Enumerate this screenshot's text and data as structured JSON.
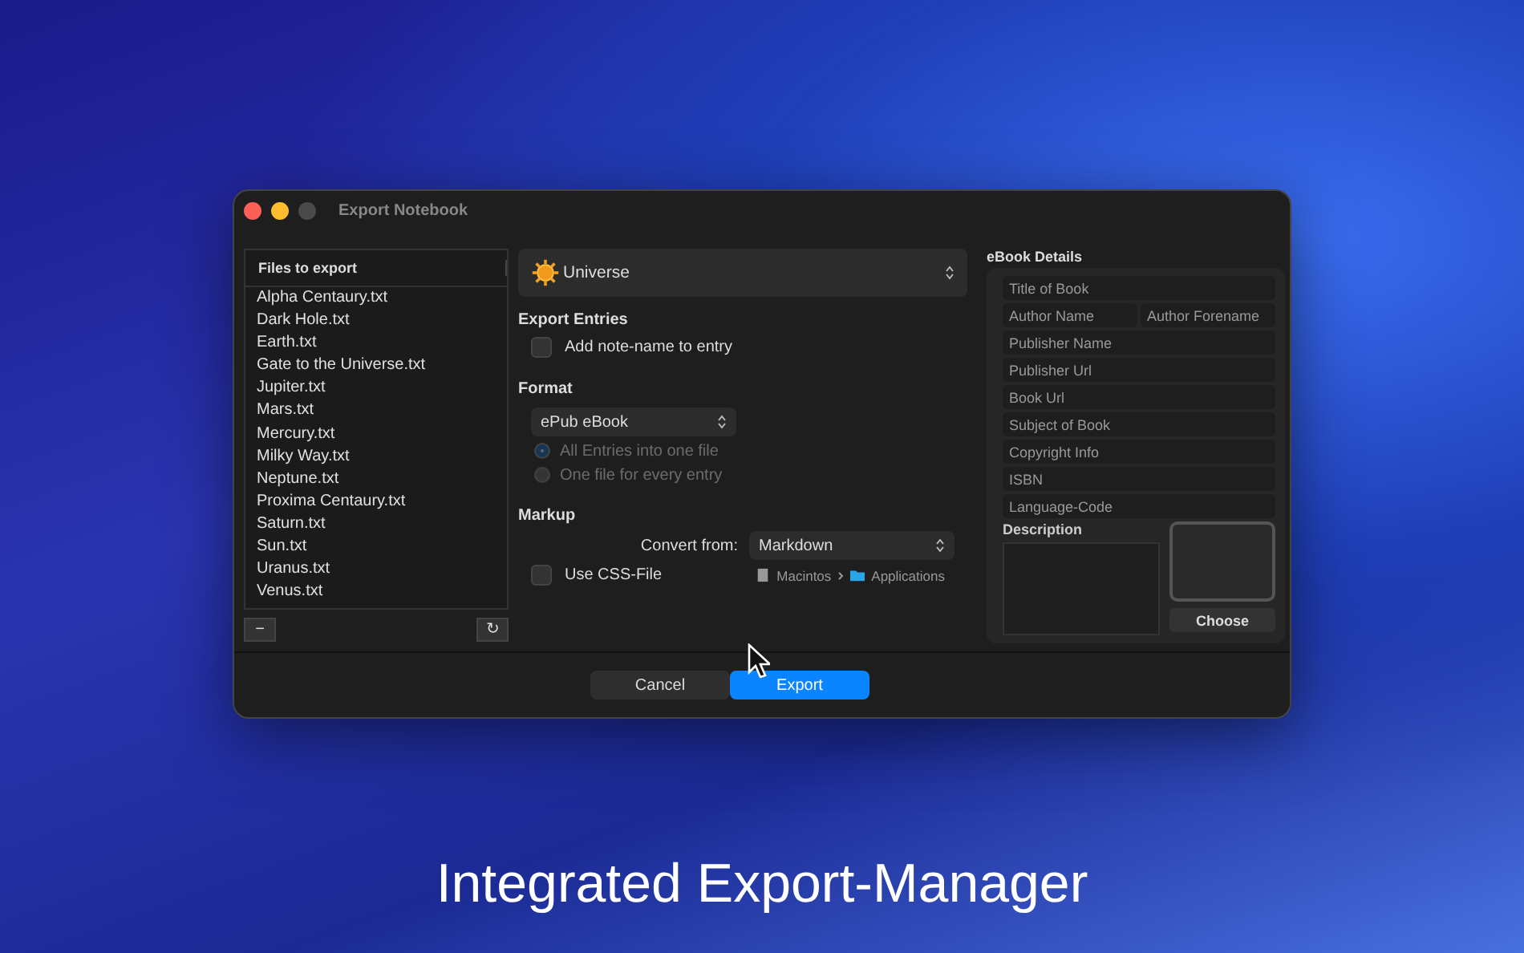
{
  "window": {
    "title": "Export Notebook"
  },
  "files": {
    "header": "Files to export",
    "items": [
      "Alpha Centaury.txt",
      "Dark Hole.txt",
      "Earth.txt",
      "Gate to the Universe.txt",
      "Jupiter.txt",
      "Mars.txt",
      "Mercury.txt",
      "Milky Way.txt",
      "Neptune.txt",
      "Proxima Centaury.txt",
      "Saturn.txt",
      "Sun.txt",
      "Uranus.txt",
      "Venus.txt"
    ],
    "remove_button": "−",
    "refresh_button": "↻"
  },
  "notebook_popup": {
    "value": "Universe"
  },
  "export_entries": {
    "heading": "Export Entries",
    "options": [
      {
        "label": "Add note-name to entry",
        "checked": false
      }
    ]
  },
  "format": {
    "heading": "Format",
    "popup": "ePub eBook",
    "radios": [
      {
        "label": "All Entries into one file",
        "selected": true,
        "disabled": true
      },
      {
        "label": "One file for every entry",
        "selected": false,
        "disabled": true
      }
    ]
  },
  "markup": {
    "heading": "Markup",
    "convert_label": "Convert from:",
    "convert_value": "Markdown",
    "css_option": {
      "label": "Use CSS-File",
      "checked": false
    },
    "path": [
      "Macintos",
      "Applications"
    ]
  },
  "ebook_details": {
    "heading": "eBook Details",
    "fields": [
      [
        {
          "placeholder": "Title of Book"
        }
      ],
      [
        {
          "placeholder": "Author Name"
        },
        {
          "placeholder": "Author Forename"
        }
      ],
      [
        {
          "placeholder": "Publisher Name"
        }
      ],
      [
        {
          "placeholder": "Publisher Url"
        }
      ],
      [
        {
          "placeholder": "Book Url"
        }
      ],
      [
        {
          "placeholder": "Subject of Book"
        }
      ],
      [
        {
          "placeholder": "Copyright Info"
        }
      ],
      [
        {
          "placeholder": "ISBN"
        }
      ],
      [
        {
          "placeholder": "Language-Code"
        }
      ]
    ],
    "description_label": "Description",
    "choose_button": "Choose"
  },
  "buttons": {
    "cancel": "Cancel",
    "export": "Export"
  },
  "caption": "Integrated Export-Manager"
}
